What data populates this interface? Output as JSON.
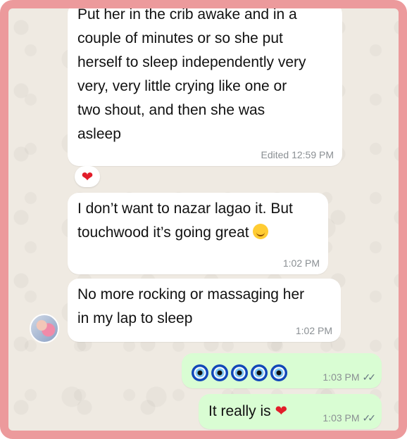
{
  "messages": [
    {
      "lines": [
        "Put her in the crib awake and in a",
        "couple of minutes or so she put",
        "herself to sleep independently very",
        "very, very little crying like one or",
        "two shout, and then she was",
        "asleep"
      ],
      "meta": "Edited 12:59 PM",
      "reaction": "heart"
    },
    {
      "lines": [
        "I don’t want to nazar lagao it. But",
        "touchwood it’s going great"
      ],
      "emoji": "smiling-face",
      "meta": "1:02 PM"
    },
    {
      "lines": [
        "No more rocking or massaging her",
        "in my lap to sleep"
      ],
      "meta": "1:02 PM",
      "avatar": true
    },
    {
      "outgoing": true,
      "content_emojis": [
        "evil-eye",
        "evil-eye",
        "evil-eye",
        "evil-eye",
        "evil-eye"
      ],
      "meta": "1:03 PM"
    },
    {
      "outgoing": true,
      "text": "It really is",
      "emoji": "red-heart",
      "meta": "1:03 PM"
    }
  ],
  "colors": {
    "frame": "#ec9a9c",
    "chat_background": "#efeae2",
    "incoming_bubble": "#ffffff",
    "outgoing_bubble": "#d9fdd3",
    "timestamp": "#8a8f93",
    "heart": "#e21d2a"
  },
  "icons": {
    "reaction": "red-heart",
    "read_receipt": "double-check-icon"
  }
}
